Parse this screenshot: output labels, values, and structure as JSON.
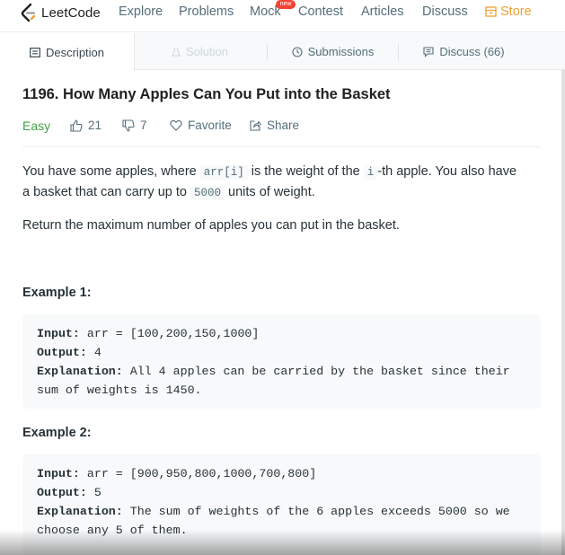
{
  "nav": {
    "logo_text": "LeetCode",
    "items": [
      "Explore",
      "Problems",
      "Mock",
      "Contest",
      "Articles",
      "Discuss",
      "Store"
    ],
    "new_badge": "new",
    "accent": "#f0a034"
  },
  "tabs": {
    "description": "Description",
    "solution": "Solution",
    "submissions": "Submissions",
    "discuss": "Discuss (66)"
  },
  "problem": {
    "title": "1196. How Many Apples Can You Put into the Basket",
    "difficulty": "Easy",
    "likes": "21",
    "dislikes": "7",
    "favorite": "Favorite",
    "share": "Share",
    "desc_line1_a": "You have some apples, where ",
    "desc_code1": "arr[i]",
    "desc_line1_b": " is the weight of the ",
    "desc_code2": "i",
    "desc_line1_c": "-th apple.  You also have",
    "desc_line2_a": "a basket that can carry up to ",
    "desc_code3": "5000",
    "desc_line2_b": " units of weight.",
    "desc_para2": "Return the maximum number of apples you can put in the basket."
  },
  "examples": [
    {
      "heading": "Example 1:",
      "input_label": "Input:",
      "input_value": " arr = [100,200,150,1000]",
      "output_label": "Output:",
      "output_value": " 4",
      "explanation_label": "Explanation:",
      "explanation_line1": " All 4 apples can be carried by the basket since their",
      "explanation_line2": "sum of weights is 1450."
    },
    {
      "heading": "Example 2:",
      "input_label": "Input:",
      "input_value": " arr = [900,950,800,1000,700,800]",
      "output_label": "Output:",
      "output_value": " 5",
      "explanation_label": "Explanation:",
      "explanation_line1": " The sum of weights of the 6 apples exceeds 5000 so we",
      "explanation_line2": "choose any 5 of them."
    }
  ]
}
